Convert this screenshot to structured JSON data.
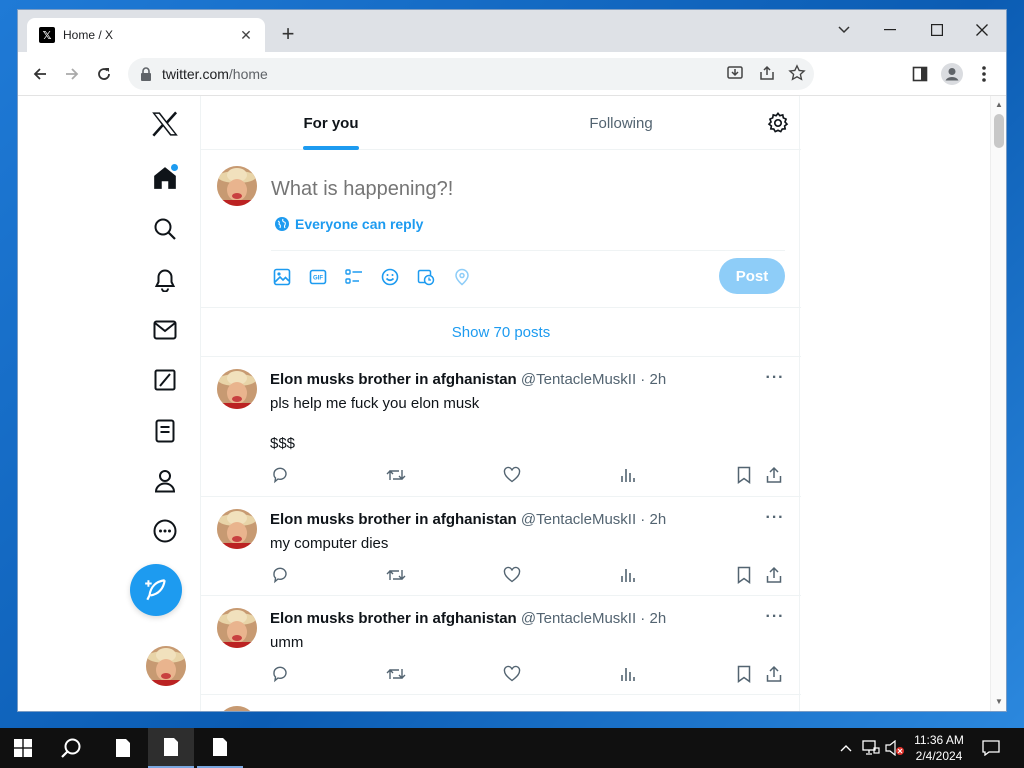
{
  "browser": {
    "tab_title": "Home / X",
    "url_host": "twitter.com",
    "url_path": "/home"
  },
  "feed": {
    "tabs": [
      {
        "label": "For you",
        "active": true
      },
      {
        "label": "Following",
        "active": false
      }
    ]
  },
  "composer": {
    "placeholder": "What is happening?!",
    "reply_setting": "Everyone can reply",
    "post_label": "Post"
  },
  "show_posts_label": "Show 70 posts",
  "tweets": [
    {
      "name": "Elon musks brother in afghanistan",
      "handle": "@TentacleMuskII · 2h",
      "text": "pls help me fuck you elon musk",
      "text2": "$$$"
    },
    {
      "name": "Elon musks brother in afghanistan",
      "handle": "@TentacleMuskII · 2h",
      "text": "my computer dies"
    },
    {
      "name": "Elon musks brother in afghanistan",
      "handle": "@TentacleMuskII · 2h",
      "text": "umm"
    }
  ],
  "taskbar": {
    "time": "11:36 AM",
    "date": "2/4/2024"
  },
  "colors": {
    "accent": "#1d9bf0",
    "post_disabled": "#8ecdf8",
    "text_primary": "#0f1419",
    "text_secondary": "#536471"
  },
  "icons": [
    "x-logo-icon",
    "home-icon",
    "search-icon",
    "bell-icon",
    "mail-icon",
    "grok-icon",
    "lists-icon",
    "profile-icon",
    "more-icon",
    "compose-icon",
    "settings-icon",
    "globe-icon",
    "image-icon",
    "gif-icon",
    "poll-icon",
    "emoji-icon",
    "schedule-icon",
    "location-icon",
    "reply-icon",
    "retweet-icon",
    "like-icon",
    "views-icon",
    "bookmark-icon",
    "share-icon"
  ]
}
